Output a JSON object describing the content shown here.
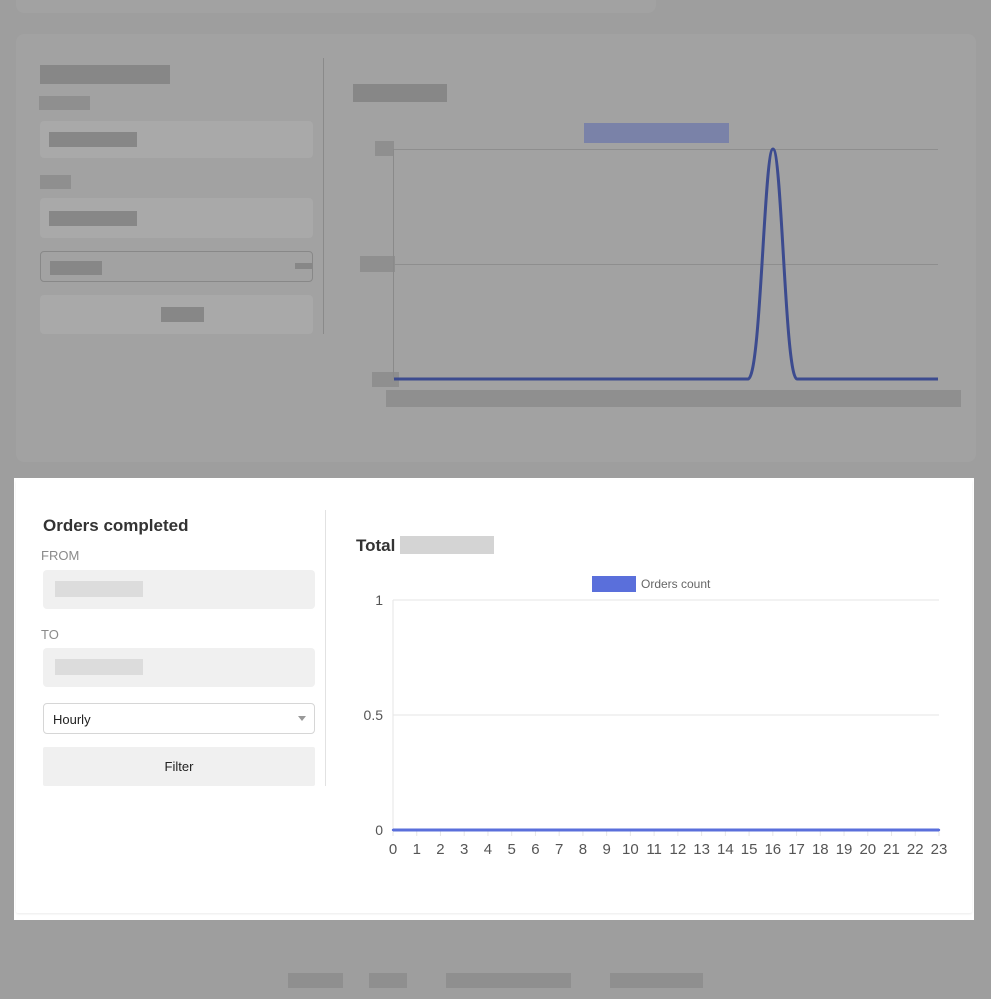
{
  "orders_panel": {
    "title": "Orders completed",
    "from_label": "FROM",
    "to_label": "TO",
    "granularity": {
      "selected": "Hourly"
    },
    "filter_label": "Filter",
    "total_label": "Total"
  },
  "colors": {
    "series": "#5a6fdb",
    "text": "#333333",
    "grid": "#e6e6e6"
  },
  "chart_data": {
    "type": "line",
    "legend": "Orders count",
    "legend_position": "top",
    "x": [
      0,
      1,
      2,
      3,
      4,
      5,
      6,
      7,
      8,
      9,
      10,
      11,
      12,
      13,
      14,
      15,
      16,
      17,
      18,
      19,
      20,
      21,
      22,
      23
    ],
    "series": [
      {
        "name": "Orders count",
        "values": [
          0,
          0,
          0,
          0,
          0,
          0,
          0,
          0,
          0,
          0,
          0,
          0,
          0,
          0,
          0,
          0,
          0,
          0,
          0,
          0,
          0,
          0,
          0,
          0
        ]
      }
    ],
    "ylim": [
      0,
      1
    ],
    "yticks": [
      "0",
      "0.5",
      "1"
    ],
    "grid": true
  }
}
